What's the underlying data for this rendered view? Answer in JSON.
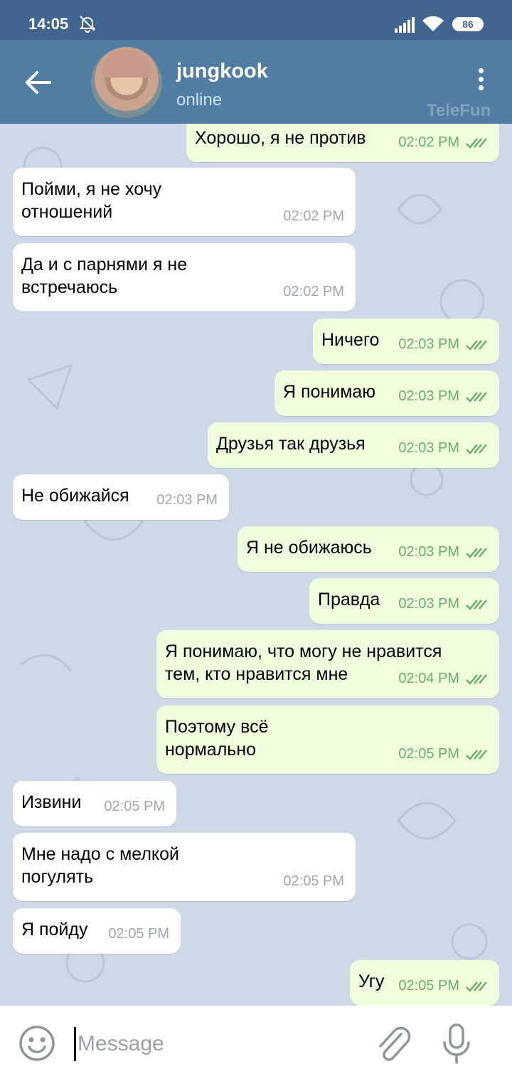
{
  "status_bar": {
    "time": "14:05",
    "battery": "86"
  },
  "header": {
    "title": "jungkook",
    "status": "online",
    "watermark": "TeleFun"
  },
  "messages": [
    {
      "dir": "out",
      "text": "Хорошо, я не против",
      "time": "02:02 PM"
    },
    {
      "dir": "in",
      "text": "Пойми, я не хочу\nотношений",
      "time": "02:02 PM"
    },
    {
      "dir": "in",
      "text": "Да и с парнями я не\nвстречаюсь",
      "time": "02:02 PM"
    },
    {
      "dir": "out",
      "text": "Ничего",
      "time": "02:03 PM"
    },
    {
      "dir": "out",
      "text": "Я понимаю",
      "time": "02:03 PM"
    },
    {
      "dir": "out",
      "text": "Друзья так друзья",
      "time": "02:03 PM"
    },
    {
      "dir": "in",
      "text": "Не обижайся",
      "time": "02:03 PM"
    },
    {
      "dir": "out",
      "text": "Я не обижаюсь",
      "time": "02:03 PM"
    },
    {
      "dir": "out",
      "text": "Правда",
      "time": "02:03 PM"
    },
    {
      "dir": "out",
      "text": "Я понимаю, что могу не нравится\nтем, кто нравится мне",
      "time": "02:04 PM"
    },
    {
      "dir": "out",
      "text": "Поэтому всё\nнормально",
      "time": "02:05 PM"
    },
    {
      "dir": "in",
      "text": "Извини",
      "time": "02:05 PM"
    },
    {
      "dir": "in",
      "text": "Мне надо с мелкой\nпогулять",
      "time": "02:05 PM"
    },
    {
      "dir": "in",
      "text": "Я пойду",
      "time": "02:05 PM"
    },
    {
      "dir": "out",
      "text": "Угу",
      "time": "02:05 PM"
    }
  ],
  "input": {
    "placeholder": "Message"
  },
  "icons": {
    "back": "arrow-left-icon",
    "menu": "more-vertical-icon",
    "emoji": "smiley-icon",
    "attach": "paperclip-icon",
    "mic": "microphone-icon",
    "read": "double-check-icon",
    "mute": "bell-off-icon",
    "signal": "signal-icon",
    "wifi": "wifi-icon"
  },
  "colors": {
    "header": "#517da2",
    "status_bar": "#41658f",
    "outgoing": "#effedd",
    "incoming": "#ffffff",
    "check": "#6eab6d"
  }
}
